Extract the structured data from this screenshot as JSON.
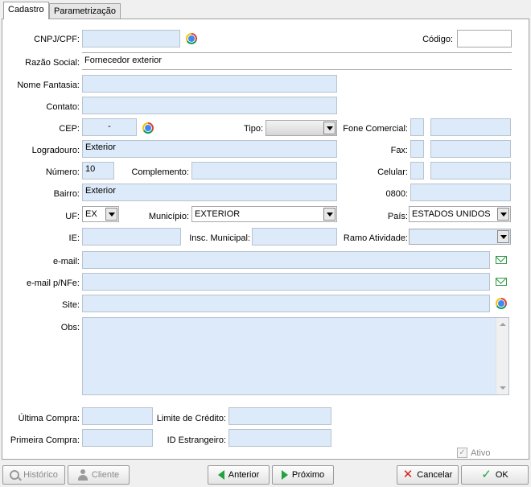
{
  "tabs": [
    "Cadastro",
    "Parametrização"
  ],
  "form": {
    "cnpj_label": "CNPJ/CPF:",
    "cnpj_value": "",
    "codigo_label": "Código:",
    "codigo_value": "",
    "razao_label": "Razão Social:",
    "razao_value": "Fornecedor exterior",
    "fantasia_label": "Nome Fantasia:",
    "fantasia_value": "",
    "contato_label": "Contato:",
    "contato_value": "",
    "cep_label": "CEP:",
    "cep_value": "-",
    "tipo_label": "Tipo:",
    "tipo_value": "",
    "fone_label": "Fone Comercial:",
    "logradouro_label": "Logradouro:",
    "logradouro_value": "Exterior",
    "fax_label": "Fax:",
    "numero_label": "Número:",
    "numero_value": "10",
    "complemento_label": "Complemento:",
    "complemento_value": "",
    "celular_label": "Celular:",
    "bairro_label": "Bairro:",
    "bairro_value": "Exterior",
    "label_0800": "0800:",
    "uf_label": "UF:",
    "uf_value": "EX",
    "municipio_label": "Município:",
    "municipio_value": "EXTERIOR",
    "pais_label": "País:",
    "pais_value": "ESTADOS UNIDOS",
    "ie_label": "IE:",
    "insc_label": "Insc. Municipal:",
    "ramo_label": "Ramo Atividade:",
    "ramo_value": "",
    "email_label": "e-mail:",
    "email_nfe_label": "e-mail p/NFe:",
    "site_label": "Site:",
    "obs_label": "Obs:",
    "ultima_label": "Última Compra:",
    "limite_label": "Limite de Crédito:",
    "primeira_label": "Primeira Compra:",
    "id_estrangeiro_label": "ID Estrangeiro:",
    "ativo_label": "Ativo"
  },
  "buttons": {
    "historico": "Histórico",
    "cliente": "Cliente",
    "anterior": "Anterior",
    "proximo": "Próximo",
    "cancelar": "Cancelar",
    "ok": "OK"
  },
  "icons": [
    "chrome-icon",
    "mail-icon",
    "search-icon",
    "user-icon",
    "arrow-left-icon",
    "arrow-right-icon",
    "cancel-icon",
    "check-icon"
  ],
  "colors": {
    "field_bg": "#dceafa",
    "field_border": "#b7c3d0",
    "accent_green": "#23a23f",
    "cancel_red": "#d42020"
  }
}
